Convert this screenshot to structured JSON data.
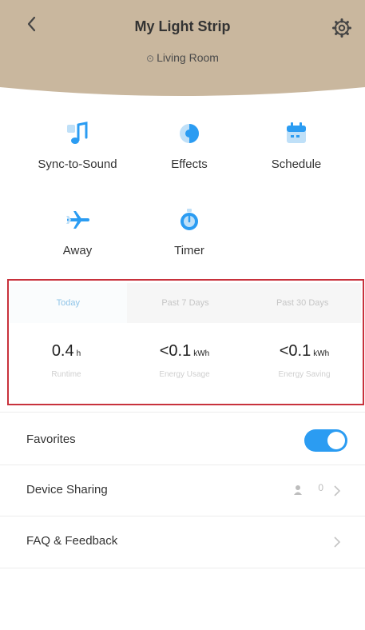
{
  "header": {
    "title": "My Light Strip",
    "location": "Living Room",
    "background_color": "#c9b79e"
  },
  "actions": [
    {
      "label": "Sync-to-Sound",
      "icon": "music-note-icon"
    },
    {
      "label": "Effects",
      "icon": "effects-icon"
    },
    {
      "label": "Schedule",
      "icon": "calendar-icon"
    },
    {
      "label": "Away",
      "icon": "airplane-icon"
    },
    {
      "label": "Timer",
      "icon": "timer-icon"
    }
  ],
  "energy": {
    "tabs": [
      "Today",
      "Past 7 Days",
      "Past 30 Days"
    ],
    "active_tab": "Today",
    "stats": [
      {
        "value": "0.4",
        "unit": "h",
        "caption": "Runtime"
      },
      {
        "value": "<0.1",
        "unit": "kWh",
        "caption": "Energy Usage"
      },
      {
        "value": "<0.1",
        "unit": "kWh",
        "caption": "Energy Saving"
      }
    ],
    "highlight_color": "#c8323c"
  },
  "settings": {
    "favorites": {
      "label": "Favorites",
      "enabled": true
    },
    "sharing": {
      "label": "Device Sharing",
      "count": "0"
    },
    "faq": {
      "label": "FAQ & Feedback"
    }
  },
  "accent_color": "#2b9cf2"
}
